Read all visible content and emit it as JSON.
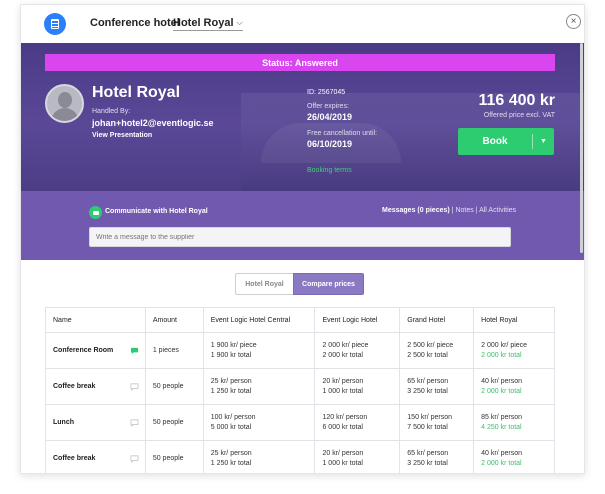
{
  "header": {
    "app_title": "Conference hotel",
    "hotel_select_value": "Hotel Royal",
    "close_symbol": "×"
  },
  "status": {
    "label": "Status: Answered",
    "color": "#d946ef"
  },
  "hotel": {
    "name": "Hotel Royal",
    "handled_by_label": "Handled By:",
    "handled_by_email": "johan+hotel2@eventlogic.se",
    "view_presentation": "View Presentation"
  },
  "details": {
    "id_label": "ID:",
    "id_value": "2567045",
    "offer_expires_label": "Offer expires:",
    "offer_expires_value": "26/04/2019",
    "free_cancellation_label": "Free cancellation until:",
    "free_cancellation_value": "06/10/2019",
    "booking_terms": "Booking terms"
  },
  "offer": {
    "price": "116 400 kr",
    "price_note": "Offered price excl. VAT",
    "book_label": "Book",
    "book_color": "#2ecc71"
  },
  "communicate": {
    "title": "Communicate with Hotel Royal",
    "messages_link": "Messages (0 pieces)",
    "sep1": "|",
    "notes_link": "Notes",
    "sep2": "|",
    "activities_link": "All Activities",
    "input_placeholder": "Write a message to the supplier"
  },
  "view_toggle": {
    "option1": "Hotel Royal",
    "option2": "Compare prices",
    "active": "Compare prices"
  },
  "table": {
    "headers": [
      "Name",
      "Amount",
      "Event Logic Hotel Central",
      "Event Logic Hotel",
      "Grand Hotel",
      "Hotel Royal"
    ],
    "rows": [
      {
        "name": "Conference Room",
        "amount": "1 pieces",
        "cells": [
          [
            "1 900 kr/ piece",
            "1 900 kr total"
          ],
          [
            "2 000 kr/ piece",
            "2 000 kr total"
          ],
          [
            "2 500 kr/ piece",
            "2 500 kr total"
          ],
          [
            "2 000 kr/ piece",
            "2 000 kr total"
          ]
        ]
      },
      {
        "name": "Coffee break",
        "amount": "50 people",
        "cells": [
          [
            "25 kr/ person",
            "1 250 kr total"
          ],
          [
            "20 kr/ person",
            "1 000 kr total"
          ],
          [
            "65 kr/ person",
            "3 250 kr total"
          ],
          [
            "40 kr/ person",
            "2 000 kr total"
          ]
        ]
      },
      {
        "name": "Lunch",
        "amount": "50 people",
        "cells": [
          [
            "100 kr/ person",
            "5 000 kr total"
          ],
          [
            "120 kr/ person",
            "6 000 kr total"
          ],
          [
            "150 kr/ person",
            "7 500 kr total"
          ],
          [
            "85 kr/ person",
            "4 250 kr total"
          ]
        ]
      },
      {
        "name": "Coffee break",
        "amount": "50 people",
        "cells": [
          [
            "25 kr/ person",
            "1 250 kr total"
          ],
          [
            "20 kr/ person",
            "1 000 kr total"
          ],
          [
            "65 kr/ person",
            "3 250 kr total"
          ],
          [
            "40 kr/ person",
            "2 000 kr total"
          ]
        ]
      }
    ]
  },
  "colors": {
    "hero_purple": "#4b3b86",
    "comm_purple": "#7159b0",
    "accent_green": "#2ecc71",
    "status_magenta": "#d946ef",
    "brand_blue": "#2d7ff9"
  }
}
